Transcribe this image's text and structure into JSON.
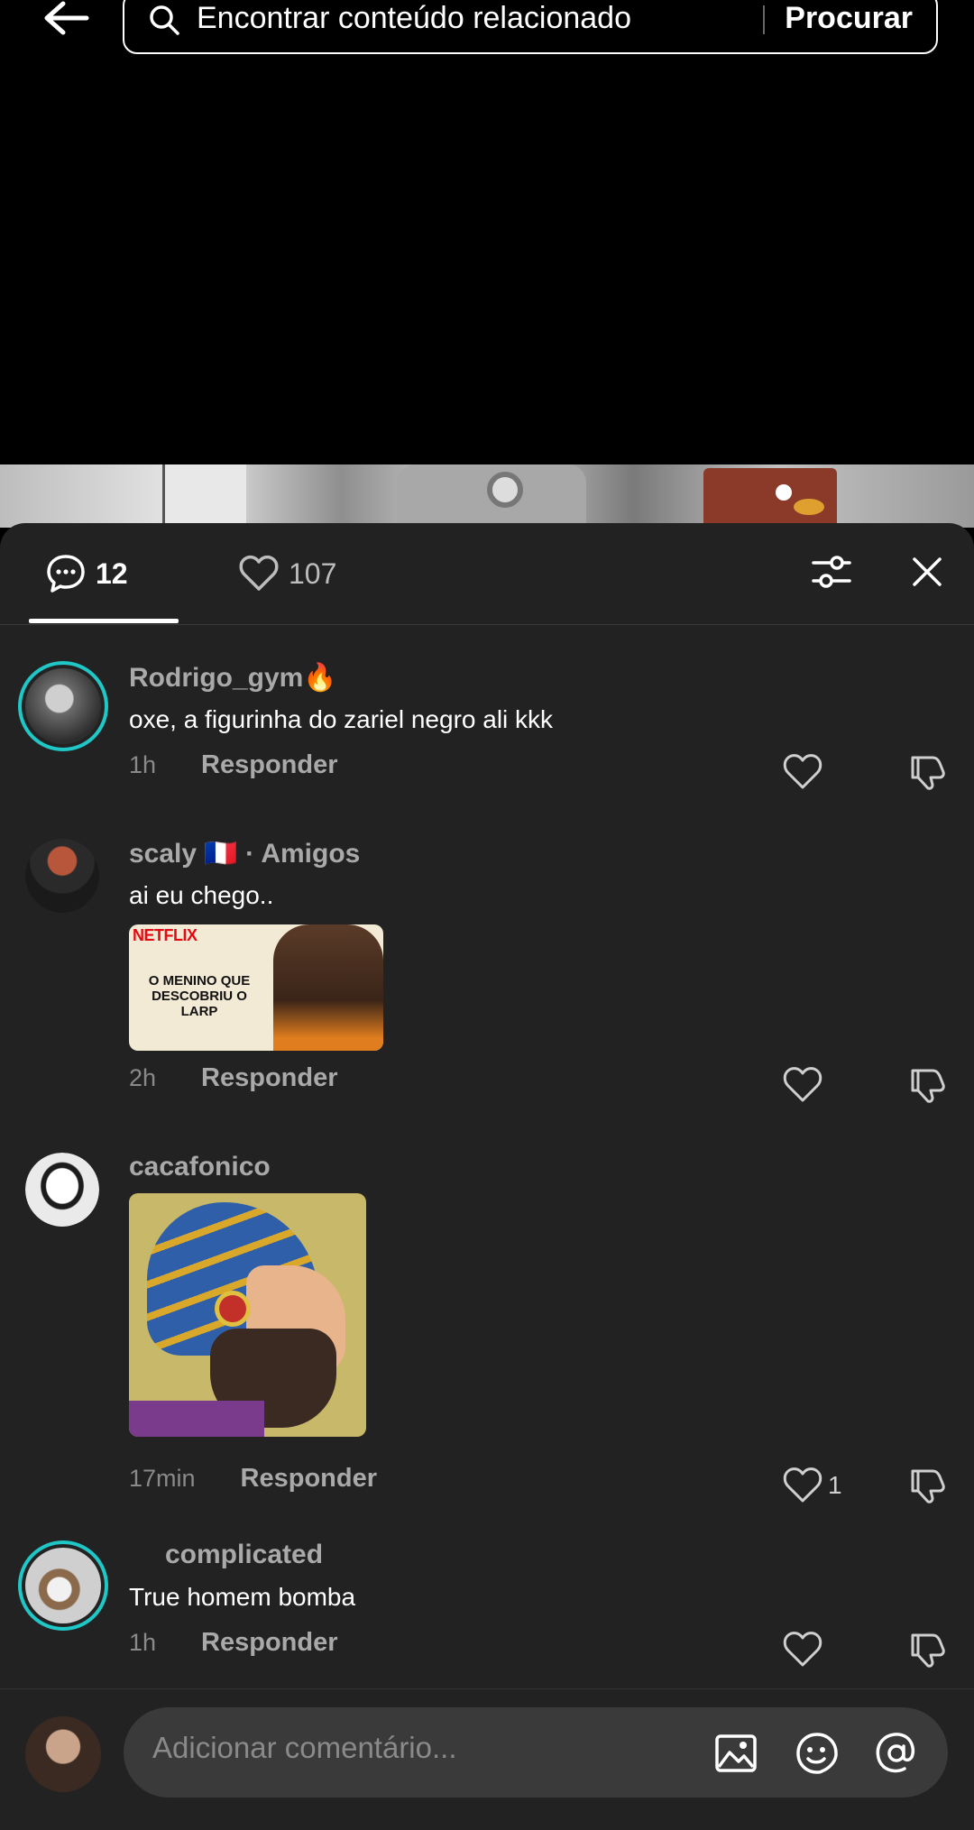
{
  "search": {
    "placeholder": "Encontrar conteúdo relacionado",
    "button": "Procurar"
  },
  "tabs": {
    "comments_count": "12",
    "likes_count": "107"
  },
  "comments": [
    {
      "username": "Rodrigo_gym",
      "username_emoji": "🔥",
      "text": "oxe, a figurinha do zariel negro ali kkk",
      "time": "1h",
      "reply": "Responder",
      "likes": ""
    },
    {
      "username": "scaly",
      "username_flag": "🇫🇷",
      "username_tag": "· Amigos",
      "text": "ai eu chego..",
      "image": {
        "brand": "NETFLIX",
        "title": "O MENINO QUE DESCOBRIU O LARP"
      },
      "time": "2h",
      "reply": "Responder",
      "likes": ""
    },
    {
      "username": "cacafonico",
      "text": "",
      "time": "17min",
      "reply": "Responder",
      "likes": "1"
    },
    {
      "username": "complicated",
      "text": "True homem bomba",
      "time": "1h",
      "reply": "Responder",
      "likes": ""
    }
  ],
  "composer": {
    "placeholder": "Adicionar comentário..."
  },
  "icons": {
    "back": "arrow-left-icon",
    "search": "search-icon",
    "comments": "comment-bubble-icon",
    "likes": "heart-icon",
    "filter": "sliders-icon",
    "close": "close-icon",
    "like": "heart-outline-icon",
    "dislike": "thumbs-down-icon",
    "image": "image-icon",
    "sticker": "sticker-icon",
    "mention": "at-icon"
  },
  "colors": {
    "panel_bg": "#222222",
    "avatar_ring": "#1fc7c7",
    "netflix_red": "#e50914"
  }
}
